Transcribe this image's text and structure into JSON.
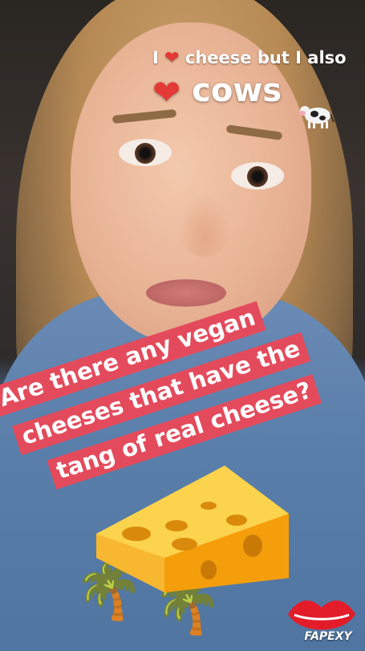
{
  "story": {
    "top_sticker": {
      "prefix": "I",
      "heart": "❤",
      "suffix": "cheese but I also"
    },
    "cows_sticker": {
      "heart": "❤",
      "text": "cows"
    },
    "cow_emoji_name": "cow-emoji",
    "question_banner": {
      "lines": [
        "Are there any vegan",
        "cheeses that have the",
        "tang of real cheese?"
      ],
      "background": "#e34b5c"
    },
    "cheese_emoji_name": "cheese-wedge-emoji",
    "watermark": {
      "text": "FAPEXY",
      "icon_name": "lips-logo-icon",
      "color": "#e31c2a"
    }
  }
}
